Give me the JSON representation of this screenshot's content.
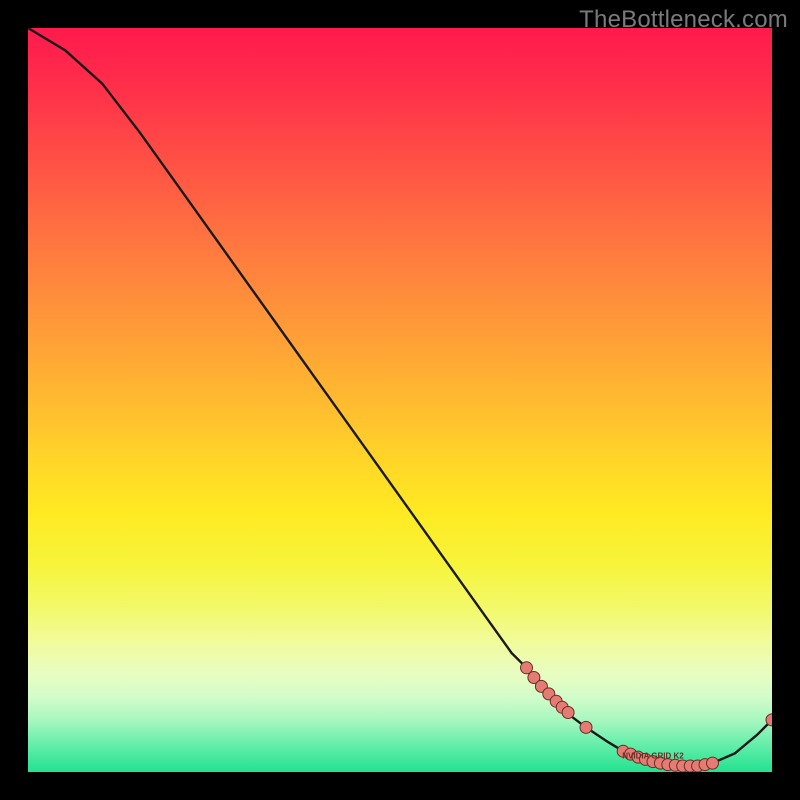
{
  "watermark": "TheBottleneck.com",
  "colors": {
    "gradient_top": "#ff1a4d",
    "gradient_mid": "#ffd528",
    "gradient_bottom": "#22e290",
    "curve_stroke": "#1a1a1a",
    "marker_fill": "#e57c73",
    "marker_stroke": "#6a2e28",
    "watermark_text": "#7a7a7a",
    "frame_bg": "#000000"
  },
  "chart_data": {
    "type": "line",
    "title": "",
    "xlabel": "",
    "ylabel": "",
    "xlim": [
      0,
      100
    ],
    "ylim": [
      0,
      100
    ],
    "grid": false,
    "legend_position": "none",
    "series": [
      {
        "name": "curve",
        "x": [
          0,
          5,
          10,
          15,
          20,
          25,
          30,
          35,
          40,
          45,
          50,
          55,
          60,
          65,
          67,
          70,
          73,
          75,
          78,
          80,
          82,
          84,
          86,
          88,
          90,
          92,
          95,
          98,
          100
        ],
        "y": [
          100,
          97,
          92.5,
          86,
          79,
          72,
          65,
          58,
          51,
          44,
          37,
          30,
          23,
          16,
          14,
          10.5,
          7.5,
          6,
          4,
          2.8,
          2.0,
          1.4,
          1.0,
          0.8,
          0.8,
          1.2,
          2.5,
          5,
          7
        ]
      }
    ],
    "markers": {
      "name": "highlighted-points",
      "x": [
        67,
        68,
        69,
        70,
        71,
        71.8,
        72.6,
        75,
        80,
        81,
        82,
        83,
        84,
        85,
        86,
        87,
        88,
        89,
        90,
        91,
        92,
        100
      ],
      "y": [
        14,
        12.7,
        11.5,
        10.5,
        9.5,
        8.7,
        8.0,
        6.0,
        2.8,
        2.4,
        2.0,
        1.7,
        1.4,
        1.2,
        1.0,
        0.9,
        0.8,
        0.8,
        0.8,
        1.0,
        1.2,
        7
      ]
    },
    "annotations": [
      {
        "text": "NVIDIA GRID K2",
        "x": 84,
        "y": 2.2
      }
    ]
  }
}
